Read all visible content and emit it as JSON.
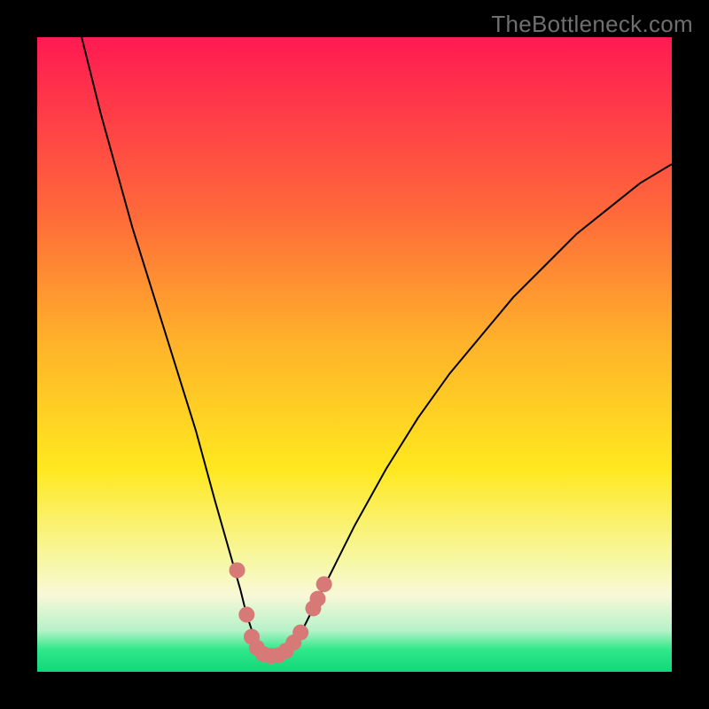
{
  "watermark": "TheBottleneck.com",
  "chart_data": {
    "type": "line",
    "title": "",
    "xlabel": "",
    "ylabel": "",
    "xlim": [
      0,
      100
    ],
    "ylim": [
      0,
      100
    ],
    "series": [
      {
        "name": "bottleneck-curve",
        "color": "#000000",
        "x": [
          7,
          10,
          15,
          20,
          25,
          28,
          30,
          32,
          33,
          34,
          35,
          36,
          37,
          38,
          39,
          40,
          41,
          42,
          44,
          47,
          50,
          55,
          60,
          65,
          70,
          75,
          80,
          85,
          90,
          95,
          100
        ],
        "y": [
          100,
          88,
          70,
          54,
          38,
          27,
          20,
          13,
          9,
          6,
          4,
          3,
          2.5,
          2.5,
          3,
          4,
          5,
          7,
          11,
          17,
          23,
          32,
          40,
          47,
          53,
          59,
          64,
          69,
          73,
          77,
          80
        ]
      }
    ],
    "markers": {
      "name": "highlight-dots",
      "color": "#d77a77",
      "points": [
        {
          "x": 31.5,
          "y": 16
        },
        {
          "x": 33.0,
          "y": 9
        },
        {
          "x": 33.8,
          "y": 5.5
        },
        {
          "x": 34.6,
          "y": 3.8
        },
        {
          "x": 35.6,
          "y": 2.8
        },
        {
          "x": 36.8,
          "y": 2.5
        },
        {
          "x": 38.0,
          "y": 2.6
        },
        {
          "x": 39.2,
          "y": 3.3
        },
        {
          "x": 40.4,
          "y": 4.6
        },
        {
          "x": 41.5,
          "y": 6.2
        },
        {
          "x": 43.5,
          "y": 10
        },
        {
          "x": 44.2,
          "y": 11.5
        },
        {
          "x": 45.2,
          "y": 13.8
        }
      ]
    },
    "background_bands": [
      {
        "name": "top-red",
        "stop": 0.0,
        "color": "#ff1a52"
      },
      {
        "name": "red-orange",
        "stop": 0.28,
        "color": "#ff6a3a"
      },
      {
        "name": "orange",
        "stop": 0.48,
        "color": "#ffb22a"
      },
      {
        "name": "yellow",
        "stop": 0.68,
        "color": "#ffe81f"
      },
      {
        "name": "pale-yellow",
        "stop": 0.82,
        "color": "#f7f7a0"
      },
      {
        "name": "cream",
        "stop": 0.88,
        "color": "#f8f8d8"
      },
      {
        "name": "mint",
        "stop": 0.935,
        "color": "#b6f2c8"
      },
      {
        "name": "green",
        "stop": 0.965,
        "color": "#2fe88a"
      },
      {
        "name": "green-end",
        "stop": 1.0,
        "color": "#12d77a"
      }
    ]
  }
}
